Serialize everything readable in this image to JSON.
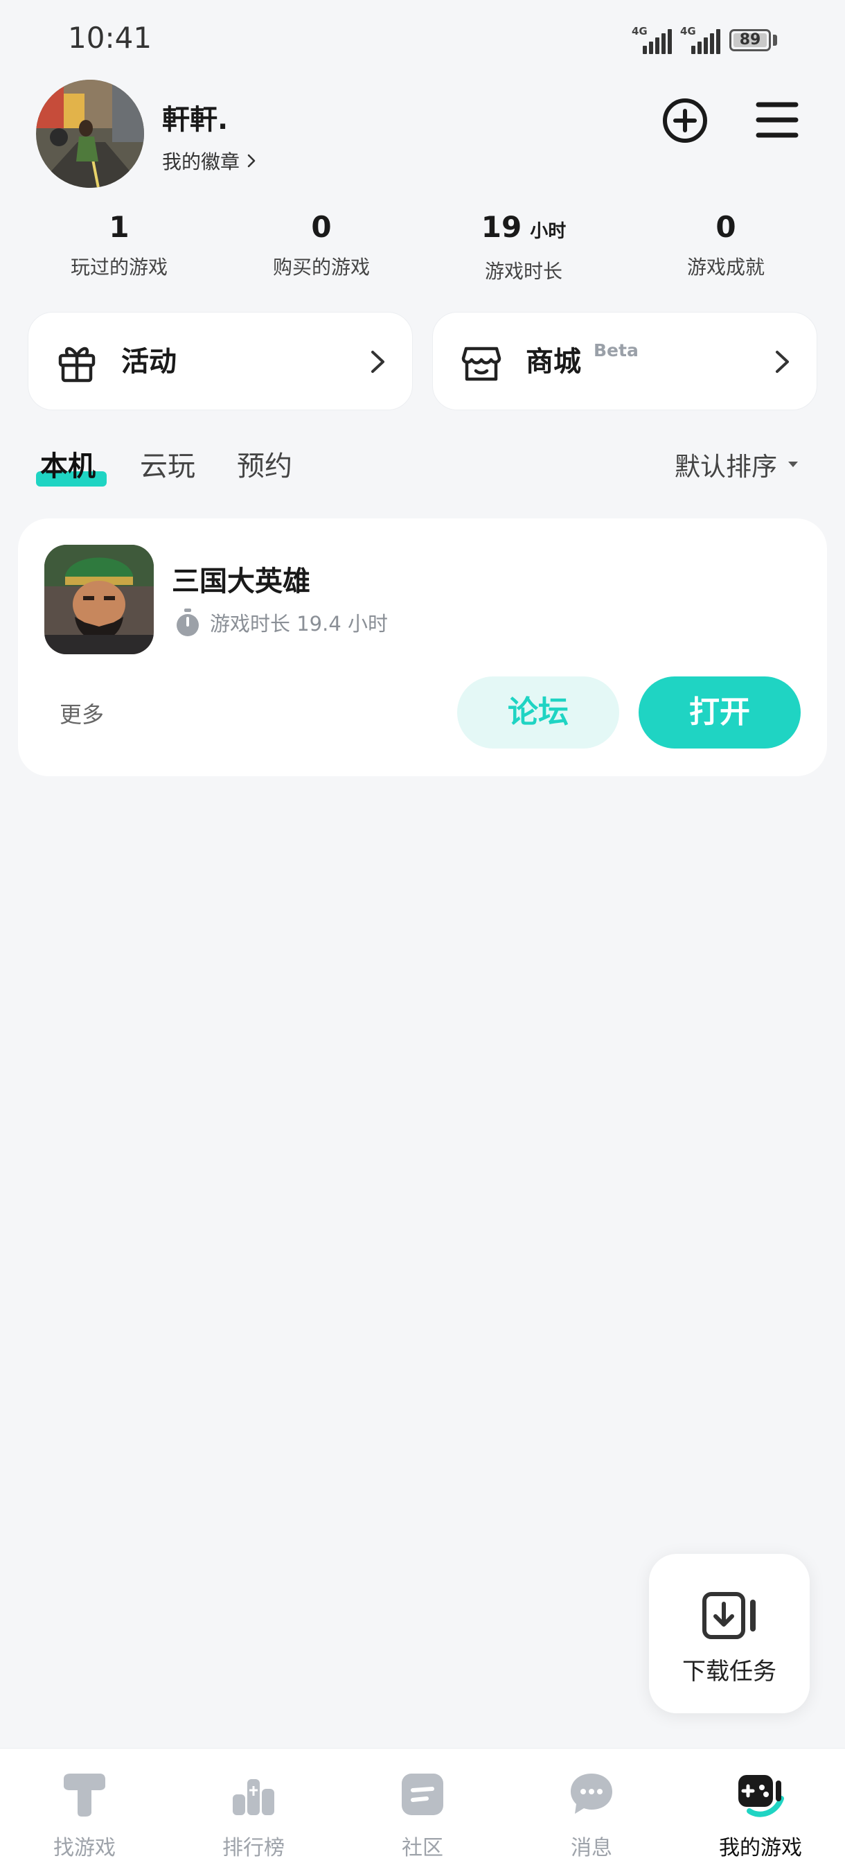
{
  "status_bar": {
    "time": "10:41",
    "network_1": "4G",
    "network_2": "4G",
    "battery": "89"
  },
  "profile": {
    "username": "軒軒.",
    "badge_link": "我的徽章"
  },
  "stats": [
    {
      "value": "1",
      "unit": "",
      "label": "玩过的游戏"
    },
    {
      "value": "0",
      "unit": "",
      "label": "购买的游戏"
    },
    {
      "value": "19",
      "unit": "小时",
      "label": "游戏时长"
    },
    {
      "value": "0",
      "unit": "",
      "label": "游戏成就"
    }
  ],
  "cards": {
    "activity": {
      "label": "活动"
    },
    "store": {
      "label": "商城",
      "badge": "Beta"
    }
  },
  "tabs": {
    "local": "本机",
    "cloud": "云玩",
    "reserve": "预约",
    "sort": "默认排序"
  },
  "game": {
    "title": "三国大英雄",
    "playtime": "游戏时长 19.4 小时",
    "more": "更多",
    "forum": "论坛",
    "open": "打开"
  },
  "download_task": {
    "label": "下载任务"
  },
  "bottom_nav": {
    "find": "找游戏",
    "rank": "排行榜",
    "community": "社区",
    "messages": "消息",
    "my_games": "我的游戏"
  },
  "colors": {
    "accent": "#1fd4c3",
    "accent_light": "#e4f8f6",
    "background": "#f5f6f8",
    "nav_inactive": "#9ea3aa"
  }
}
